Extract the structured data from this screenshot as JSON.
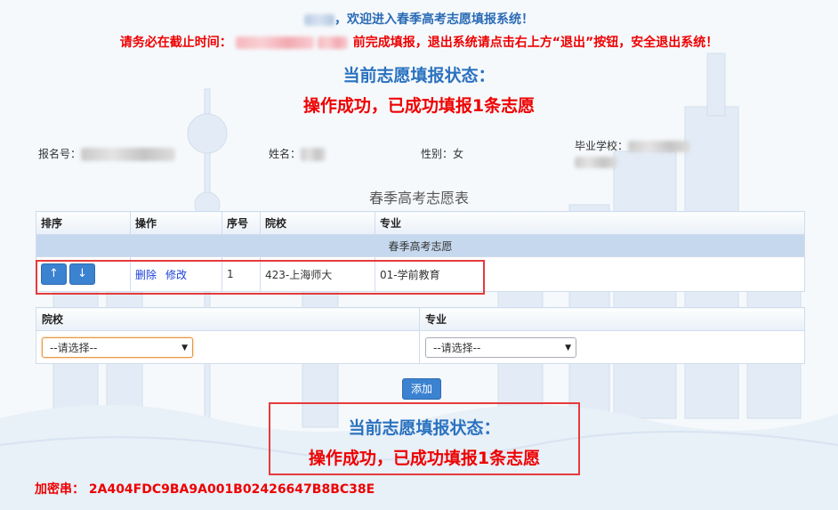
{
  "header": {
    "welcome": "，欢迎进入春季高考志愿填报系统！",
    "deadline_prefix": "请务必在截止时间：",
    "deadline_suffix": "前完成填报，退出系统请点击右上方“退出”按钮，安全退出系统！"
  },
  "status_top": {
    "title": "当前志愿填报状态：",
    "message": "操作成功，已成功填报1条志愿"
  },
  "applicant": {
    "reg_no_label": "报名号：",
    "name_label": "姓名：",
    "gender_label": "性别：",
    "gender_value": "女",
    "school_label": "毕业学校："
  },
  "table": {
    "title": "春季高考志愿表",
    "headers": [
      "排序",
      "操作",
      "序号",
      "院校",
      "专业"
    ],
    "group_label": "春季高考志愿",
    "rows": [
      {
        "up": "↑",
        "down": "↓",
        "delete": "删除",
        "edit": "修改",
        "seq": "1",
        "school": "423-上海师大",
        "major": "01-学前教育"
      }
    ]
  },
  "selector": {
    "school_label": "院校",
    "major_label": "专业",
    "school_value": "--请选择--",
    "major_value": "--请选择--"
  },
  "add_button": "添加",
  "status_bottom": {
    "title": "当前志愿填报状态：",
    "message": "操作成功，已成功填报1条志愿"
  },
  "encrypt": {
    "label": "加密串：",
    "value": "2A404FDC9BA9A001B02426647B8BC38E"
  },
  "colors": {
    "accent_blue": "#2a72bf",
    "alert_red": "#e00000",
    "highlight_box": "#e53b3b",
    "group_row": "#c5d8ee"
  }
}
